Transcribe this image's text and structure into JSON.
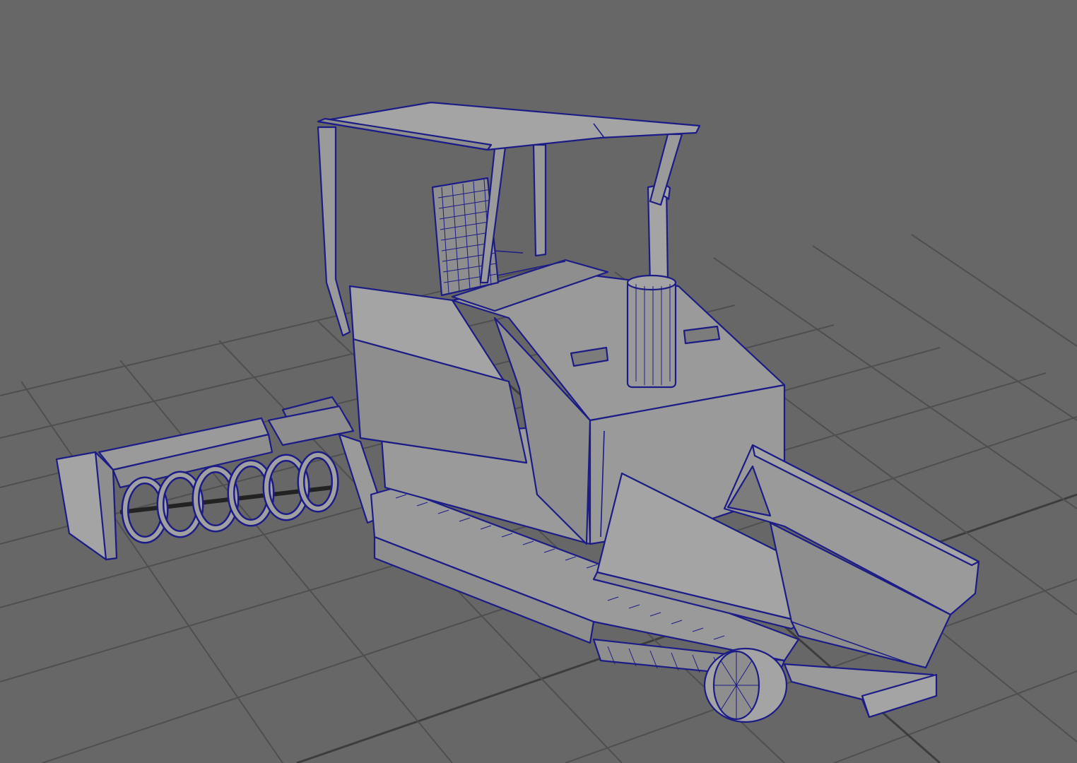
{
  "viewport": {
    "background_color": "#676767",
    "grid_color": "#4f4f4f",
    "wireframe_color": "#1c1c86",
    "shaded_color": "#9a9a9a"
  }
}
